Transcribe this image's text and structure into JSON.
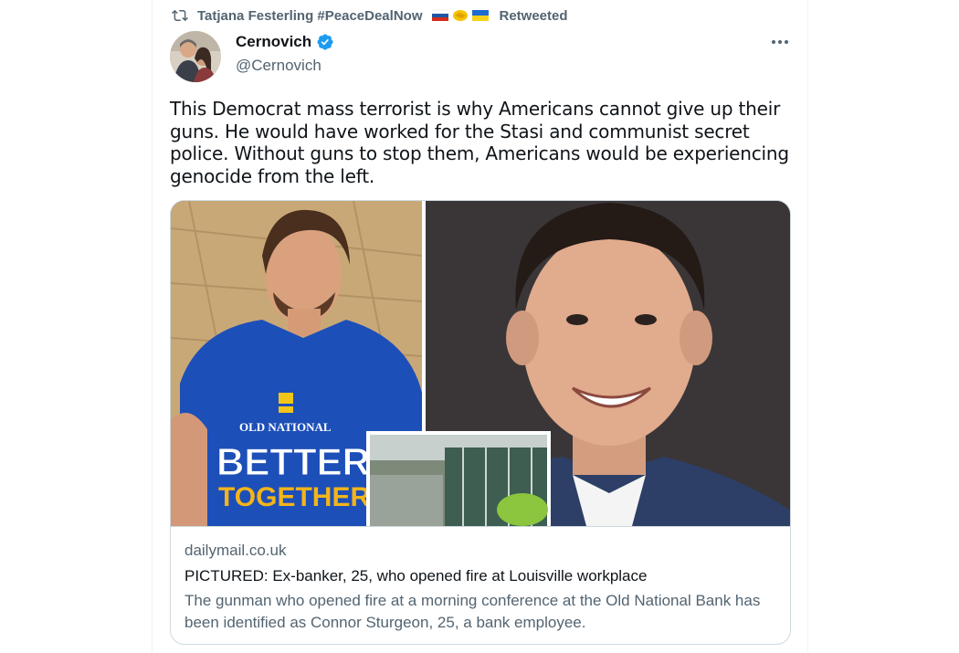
{
  "retweet": {
    "user": "Tatjana Festerling #PeaceDealNow",
    "suffix": "Retweeted",
    "flags": [
      "russia-flag",
      "handshake-emoji",
      "ukraine-flag"
    ]
  },
  "author": {
    "name": "Cernovich",
    "handle": "@Cernovich",
    "verified": true
  },
  "tweet": {
    "text": "This Democrat mass terrorist is why Americans cannot give up their guns. He would have worked for the Stasi and communist secret police. Without guns to stop them, Americans would be experiencing genocide from the left."
  },
  "card": {
    "domain": "dailymail.co.uk",
    "headline": "PICTURED: Ex-banker, 25, who opened fire at Louisville workplace",
    "description": "The gunman who opened fire at a morning conference at the Old National Bank has been identified as Connor Sturgeon, 25, a bank employee.",
    "shirt_text": {
      "brand": "OLD NATIONAL",
      "line1": "BETTER",
      "line2": "TOGETHER"
    }
  },
  "colors": {
    "accent": "#1d9bf0",
    "secondary_text": "#536471",
    "border": "#cfd9de"
  }
}
